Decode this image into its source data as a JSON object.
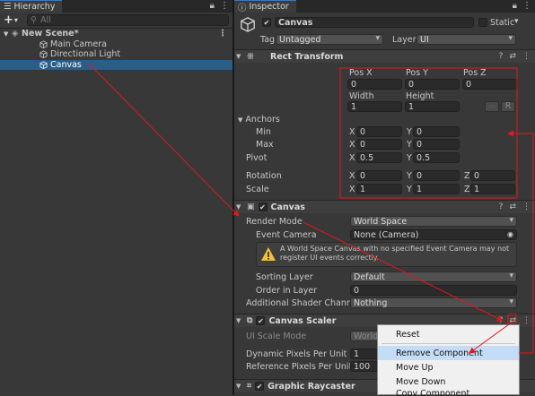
{
  "colors": {
    "selection": "#2c5d87",
    "annotation": "#e0191b",
    "tab_accent": "#3a79bb",
    "warning": "#f2c230"
  },
  "hierarchy": {
    "tab_label": "Hierarchy",
    "search_placeholder": "All",
    "scene": "New Scene*",
    "items": [
      "Main Camera",
      "Directional Light",
      "Canvas"
    ]
  },
  "inspector": {
    "tab_label": "Inspector",
    "object_name": "Canvas",
    "static_label": "Static",
    "tag_label": "Tag",
    "tag_value": "Untagged",
    "layer_label": "Layer",
    "layer_value": "UI",
    "rect": {
      "title": "Rect Transform",
      "pos_x_label": "Pos X",
      "pos_y_label": "Pos Y",
      "pos_z_label": "Pos Z",
      "pos_x": "0",
      "pos_y": "0",
      "pos_z": "0",
      "width_label": "Width",
      "height_label": "Height",
      "width": "1",
      "height": "1",
      "r_button": "R",
      "anchors_label": "Anchors",
      "min_label": "Min",
      "max_label": "Max",
      "min_x": "0",
      "min_y": "0",
      "max_x": "0",
      "max_y": "0",
      "pivot_label": "Pivot",
      "pivot_x": "0.5",
      "pivot_y": "0.5",
      "rotation_label": "Rotation",
      "rot_x": "0",
      "rot_y": "0",
      "rot_z": "0",
      "scale_label": "Scale",
      "scale_x": "1",
      "scale_y": "1",
      "scale_z": "1",
      "x": "X",
      "y": "Y",
      "z": "Z"
    },
    "canvas": {
      "title": "Canvas",
      "render_mode_label": "Render Mode",
      "render_mode": "World Space",
      "event_camera_label": "Event Camera",
      "event_camera": "None (Camera)",
      "warning": "A World Space Canvas with no specified Event Camera may not register UI events correctly.",
      "sorting_layer_label": "Sorting Layer",
      "sorting_layer": "Default",
      "order_label": "Order in Layer",
      "order": "0",
      "shader_label": "Additional Shader Channels",
      "shader": "Nothing"
    },
    "scaler": {
      "title": "Canvas Scaler",
      "ui_scale_label": "UI Scale Mode",
      "ui_scale": "World",
      "dpu_label": "Dynamic Pixels Per Unit",
      "dpu": "1",
      "rppu_label": "Reference Pixels Per Unit",
      "rppu": "100"
    },
    "raycaster": {
      "title": "Graphic Raycaster"
    }
  },
  "context_menu": {
    "items": [
      "Reset",
      "Remove Component",
      "Move Up",
      "Move Down",
      "Copy Component"
    ]
  }
}
